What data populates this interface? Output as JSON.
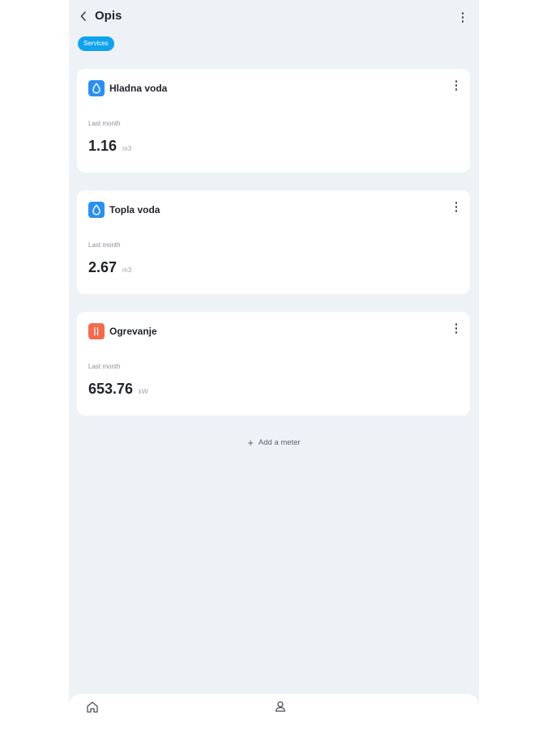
{
  "header": {
    "title": "Opis"
  },
  "tag": {
    "label": "Serviсes"
  },
  "meters": [
    {
      "name": "Hladna voda",
      "icon": "water-drop-icon",
      "icon_color": "#2b8ff0",
      "label": "Last month",
      "value": "1.16",
      "unit": "m3"
    },
    {
      "name": "Topla voda",
      "icon": "water-drop-icon",
      "icon_color": "#2b8ff0",
      "label": "Last month",
      "value": "2.67",
      "unit": "m3"
    },
    {
      "name": "Ogrevanje",
      "icon": "heating-icon",
      "icon_color": "#f26b4f",
      "label": "Last month",
      "value": "653.76",
      "unit": "kW"
    }
  ],
  "add_meter": {
    "label": "Add a meter"
  },
  "bottom_nav": {
    "items": [
      {
        "icon": "home-icon"
      },
      {
        "icon": "profile-icon"
      }
    ]
  },
  "colors": {
    "accent": "#11a3ea",
    "background": "#eef2f7"
  }
}
